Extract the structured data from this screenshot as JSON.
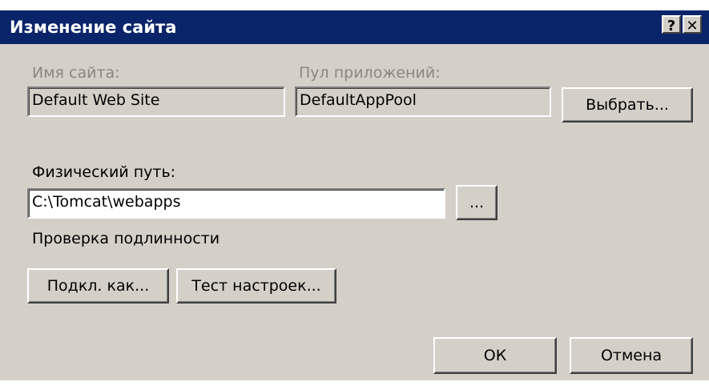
{
  "window": {
    "title": "Изменение сайта",
    "help_glyph": "?",
    "close_glyph": "✕"
  },
  "site_name": {
    "label": "Имя сайта:",
    "value": "Default Web Site"
  },
  "app_pool": {
    "label": "Пул приложений:",
    "value": "DefaultAppPool",
    "select_label": "Выбрать..."
  },
  "physical_path": {
    "label": "Физический путь:",
    "value": "C:\\Tomcat\\webapps",
    "browse_label": "..."
  },
  "auth": {
    "label": "Проверка подлинности",
    "connect_as_label": "Подкл. как...",
    "test_settings_label": "Тест настроек..."
  },
  "footer": {
    "ok_label": "ОК",
    "cancel_label": "Отмена"
  },
  "colors": {
    "titlebar": "#0a246a",
    "dialog_bg": "#d4d0c8",
    "disabled_text": "#8a877e"
  }
}
